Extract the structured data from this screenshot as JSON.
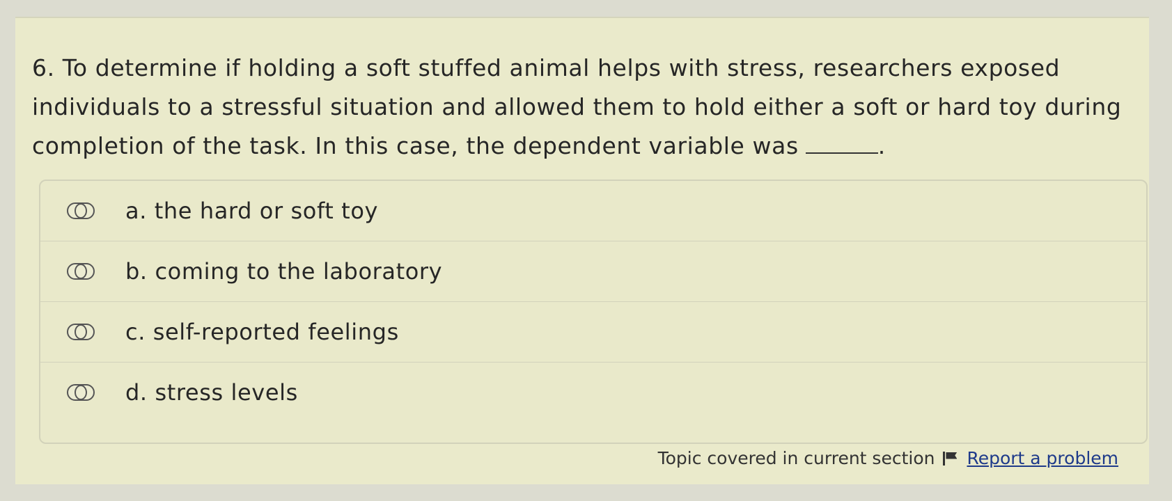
{
  "question": {
    "text": "6. To determine if holding a soft stuffed animal helps with stress, researchers exposed individuals to a stressful situation and allowed them to hold either a soft or hard toy during completion of the task. In this case, the dependent variable was",
    "end_punct": "."
  },
  "options": [
    {
      "label": "a. the hard or soft toy"
    },
    {
      "label": "b. coming to the laboratory"
    },
    {
      "label": "c. self-reported feelings"
    },
    {
      "label": "d. stress levels"
    }
  ],
  "footer": {
    "topic_text": "Topic covered in current section",
    "report_link": "Report a problem",
    "flag_icon": "flag-icon"
  }
}
